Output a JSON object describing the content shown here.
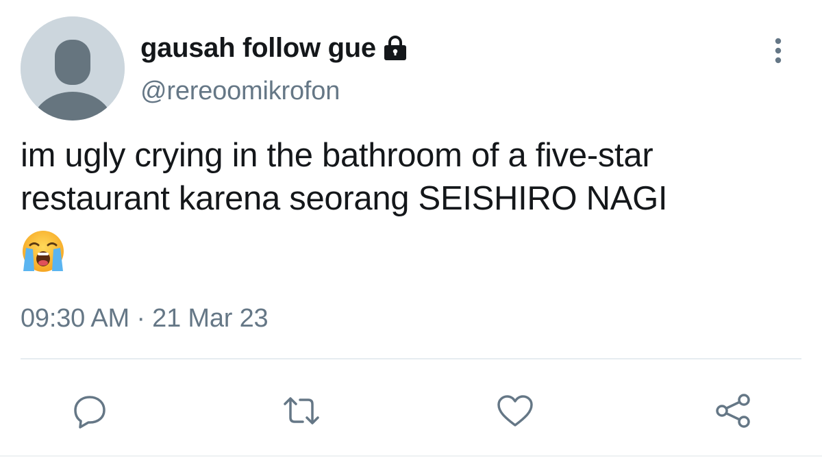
{
  "tweet": {
    "display_name": "gausah follow gue",
    "handle": "@rereoomikrofon",
    "text": "im ugly crying in the bathroom of a five-star restaurant karena seorang SEISHIRO NAGI",
    "emoji": "loudly-crying-face",
    "time": "09:30 AM",
    "separator": "·",
    "date": "21 Mar 23",
    "protected": true
  },
  "icons": {
    "avatar": "default-avatar-icon",
    "lock": "lock-icon",
    "more": "more-vertical-icon",
    "reply": "reply-icon",
    "retweet": "retweet-icon",
    "like": "heart-icon",
    "share": "share-icon"
  },
  "colors": {
    "text_primary": "#14171a",
    "text_secondary": "#657786",
    "icon_gray": "#657786",
    "avatar_bg": "#ccd6dd",
    "avatar_fg": "#66757f",
    "divider": "#e6ecf0"
  }
}
